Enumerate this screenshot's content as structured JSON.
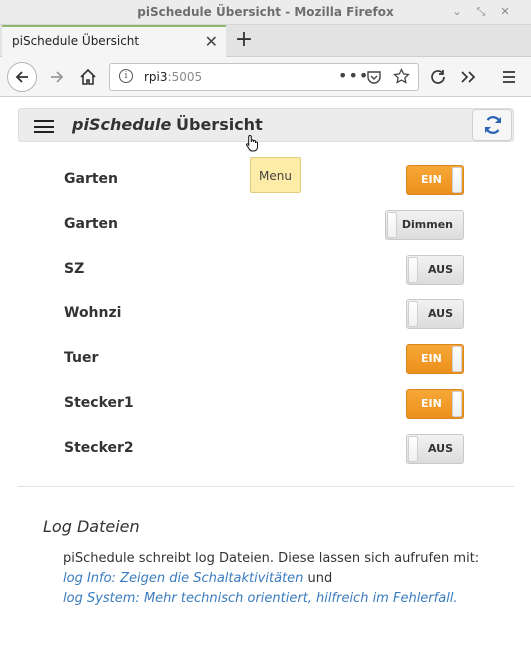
{
  "window": {
    "title": "piSchedule Übersicht - Mozilla Firefox"
  },
  "tab": {
    "label": "piSchedule Übersicht"
  },
  "url": {
    "host": "rpi3",
    "port": ":5005"
  },
  "header": {
    "brand": "piSchedule",
    "title": "Übersicht",
    "tooltip": "Menu"
  },
  "devices": [
    {
      "name": "Garten",
      "state": "EIN",
      "on": true
    },
    {
      "name": "Garten",
      "state": "Dimmen",
      "on": false
    },
    {
      "name": "SZ",
      "state": "AUS",
      "on": false
    },
    {
      "name": "Wohnzi",
      "state": "AUS",
      "on": false
    },
    {
      "name": "Tuer",
      "state": "EIN",
      "on": true
    },
    {
      "name": "Stecker1",
      "state": "EIN",
      "on": true
    },
    {
      "name": "Stecker2",
      "state": "AUS",
      "on": false
    }
  ],
  "log": {
    "title": "Log Dateien",
    "intro": "piSchedule schreibt log Dateien. Diese lassen sich aufrufen mit:",
    "link_info": "log Info: Zeigen die Schaltaktivitäten",
    "and": " und",
    "link_system": "log System: Mehr technisch orientiert, hilfreich im Fehlerfall."
  },
  "colors": {
    "toggle_on": "#f29d2a",
    "link": "#3a7cbf",
    "tooltip": "#fdeca7"
  }
}
